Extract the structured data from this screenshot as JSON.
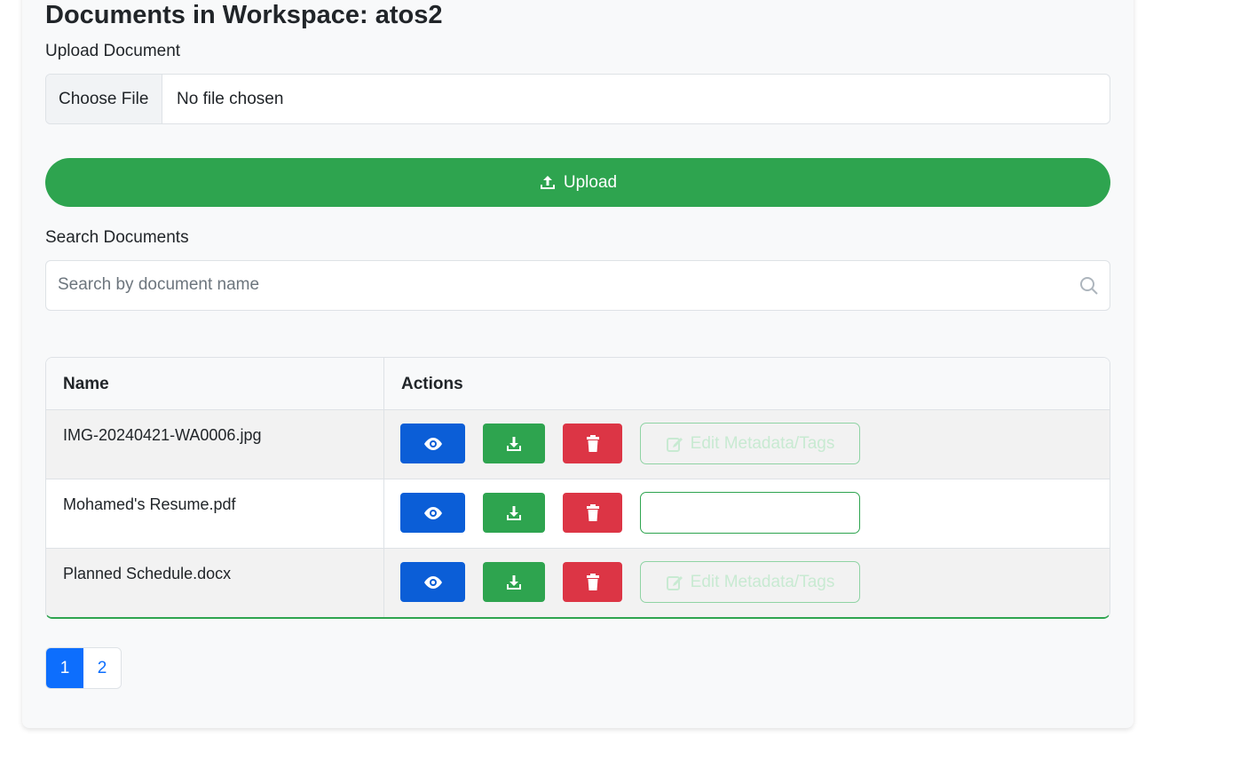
{
  "page": {
    "title": "Documents in Workspace: atos2"
  },
  "upload": {
    "label": "Upload Document",
    "choose_file_label": "Choose File",
    "file_status": "No file chosen",
    "button_label": "Upload",
    "button_icon": "upload-icon"
  },
  "search": {
    "label": "Search Documents",
    "placeholder": "Search by document name",
    "value": "",
    "icon": "search-icon"
  },
  "table": {
    "headers": [
      "Name",
      "Actions"
    ],
    "rows": [
      {
        "name": "IMG-20240421-WA0006.jpg",
        "edit_label": "Edit Metadata/Tags"
      },
      {
        "name": "Mohamed's Resume.pdf",
        "edit_label": ""
      },
      {
        "name": "Planned Schedule.docx",
        "edit_label": "Edit Metadata/Tags"
      }
    ]
  },
  "pagination": {
    "pages": [
      "1",
      "2"
    ],
    "active": "1"
  },
  "colors": {
    "primary": "#0b5ed7",
    "success": "#2ea44f",
    "danger": "#dc3545",
    "background": "#f8f9fa"
  }
}
